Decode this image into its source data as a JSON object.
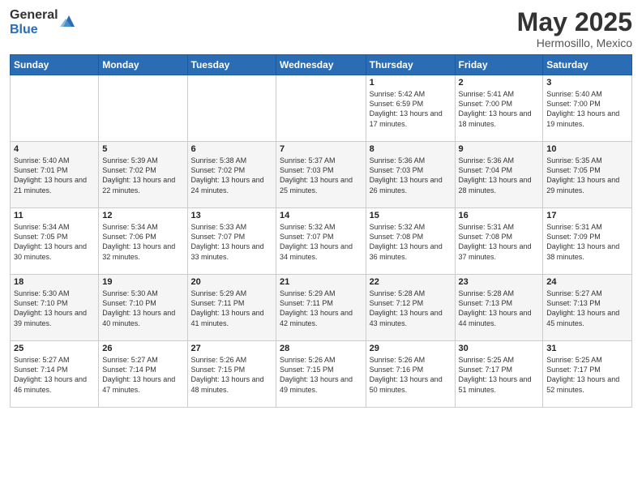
{
  "header": {
    "logo_general": "General",
    "logo_blue": "Blue",
    "month": "May 2025",
    "location": "Hermosillo, Mexico"
  },
  "weekdays": [
    "Sunday",
    "Monday",
    "Tuesday",
    "Wednesday",
    "Thursday",
    "Friday",
    "Saturday"
  ],
  "weeks": [
    [
      {
        "day": "",
        "sunrise": "",
        "sunset": "",
        "daylight": ""
      },
      {
        "day": "",
        "sunrise": "",
        "sunset": "",
        "daylight": ""
      },
      {
        "day": "",
        "sunrise": "",
        "sunset": "",
        "daylight": ""
      },
      {
        "day": "",
        "sunrise": "",
        "sunset": "",
        "daylight": ""
      },
      {
        "day": "1",
        "sunrise": "Sunrise: 5:42 AM",
        "sunset": "Sunset: 6:59 PM",
        "daylight": "Daylight: 13 hours and 17 minutes."
      },
      {
        "day": "2",
        "sunrise": "Sunrise: 5:41 AM",
        "sunset": "Sunset: 7:00 PM",
        "daylight": "Daylight: 13 hours and 18 minutes."
      },
      {
        "day": "3",
        "sunrise": "Sunrise: 5:40 AM",
        "sunset": "Sunset: 7:00 PM",
        "daylight": "Daylight: 13 hours and 19 minutes."
      }
    ],
    [
      {
        "day": "4",
        "sunrise": "Sunrise: 5:40 AM",
        "sunset": "Sunset: 7:01 PM",
        "daylight": "Daylight: 13 hours and 21 minutes."
      },
      {
        "day": "5",
        "sunrise": "Sunrise: 5:39 AM",
        "sunset": "Sunset: 7:02 PM",
        "daylight": "Daylight: 13 hours and 22 minutes."
      },
      {
        "day": "6",
        "sunrise": "Sunrise: 5:38 AM",
        "sunset": "Sunset: 7:02 PM",
        "daylight": "Daylight: 13 hours and 24 minutes."
      },
      {
        "day": "7",
        "sunrise": "Sunrise: 5:37 AM",
        "sunset": "Sunset: 7:03 PM",
        "daylight": "Daylight: 13 hours and 25 minutes."
      },
      {
        "day": "8",
        "sunrise": "Sunrise: 5:36 AM",
        "sunset": "Sunset: 7:03 PM",
        "daylight": "Daylight: 13 hours and 26 minutes."
      },
      {
        "day": "9",
        "sunrise": "Sunrise: 5:36 AM",
        "sunset": "Sunset: 7:04 PM",
        "daylight": "Daylight: 13 hours and 28 minutes."
      },
      {
        "day": "10",
        "sunrise": "Sunrise: 5:35 AM",
        "sunset": "Sunset: 7:05 PM",
        "daylight": "Daylight: 13 hours and 29 minutes."
      }
    ],
    [
      {
        "day": "11",
        "sunrise": "Sunrise: 5:34 AM",
        "sunset": "Sunset: 7:05 PM",
        "daylight": "Daylight: 13 hours and 30 minutes."
      },
      {
        "day": "12",
        "sunrise": "Sunrise: 5:34 AM",
        "sunset": "Sunset: 7:06 PM",
        "daylight": "Daylight: 13 hours and 32 minutes."
      },
      {
        "day": "13",
        "sunrise": "Sunrise: 5:33 AM",
        "sunset": "Sunset: 7:07 PM",
        "daylight": "Daylight: 13 hours and 33 minutes."
      },
      {
        "day": "14",
        "sunrise": "Sunrise: 5:32 AM",
        "sunset": "Sunset: 7:07 PM",
        "daylight": "Daylight: 13 hours and 34 minutes."
      },
      {
        "day": "15",
        "sunrise": "Sunrise: 5:32 AM",
        "sunset": "Sunset: 7:08 PM",
        "daylight": "Daylight: 13 hours and 36 minutes."
      },
      {
        "day": "16",
        "sunrise": "Sunrise: 5:31 AM",
        "sunset": "Sunset: 7:08 PM",
        "daylight": "Daylight: 13 hours and 37 minutes."
      },
      {
        "day": "17",
        "sunrise": "Sunrise: 5:31 AM",
        "sunset": "Sunset: 7:09 PM",
        "daylight": "Daylight: 13 hours and 38 minutes."
      }
    ],
    [
      {
        "day": "18",
        "sunrise": "Sunrise: 5:30 AM",
        "sunset": "Sunset: 7:10 PM",
        "daylight": "Daylight: 13 hours and 39 minutes."
      },
      {
        "day": "19",
        "sunrise": "Sunrise: 5:30 AM",
        "sunset": "Sunset: 7:10 PM",
        "daylight": "Daylight: 13 hours and 40 minutes."
      },
      {
        "day": "20",
        "sunrise": "Sunrise: 5:29 AM",
        "sunset": "Sunset: 7:11 PM",
        "daylight": "Daylight: 13 hours and 41 minutes."
      },
      {
        "day": "21",
        "sunrise": "Sunrise: 5:29 AM",
        "sunset": "Sunset: 7:11 PM",
        "daylight": "Daylight: 13 hours and 42 minutes."
      },
      {
        "day": "22",
        "sunrise": "Sunrise: 5:28 AM",
        "sunset": "Sunset: 7:12 PM",
        "daylight": "Daylight: 13 hours and 43 minutes."
      },
      {
        "day": "23",
        "sunrise": "Sunrise: 5:28 AM",
        "sunset": "Sunset: 7:13 PM",
        "daylight": "Daylight: 13 hours and 44 minutes."
      },
      {
        "day": "24",
        "sunrise": "Sunrise: 5:27 AM",
        "sunset": "Sunset: 7:13 PM",
        "daylight": "Daylight: 13 hours and 45 minutes."
      }
    ],
    [
      {
        "day": "25",
        "sunrise": "Sunrise: 5:27 AM",
        "sunset": "Sunset: 7:14 PM",
        "daylight": "Daylight: 13 hours and 46 minutes."
      },
      {
        "day": "26",
        "sunrise": "Sunrise: 5:27 AM",
        "sunset": "Sunset: 7:14 PM",
        "daylight": "Daylight: 13 hours and 47 minutes."
      },
      {
        "day": "27",
        "sunrise": "Sunrise: 5:26 AM",
        "sunset": "Sunset: 7:15 PM",
        "daylight": "Daylight: 13 hours and 48 minutes."
      },
      {
        "day": "28",
        "sunrise": "Sunrise: 5:26 AM",
        "sunset": "Sunset: 7:15 PM",
        "daylight": "Daylight: 13 hours and 49 minutes."
      },
      {
        "day": "29",
        "sunrise": "Sunrise: 5:26 AM",
        "sunset": "Sunset: 7:16 PM",
        "daylight": "Daylight: 13 hours and 50 minutes."
      },
      {
        "day": "30",
        "sunrise": "Sunrise: 5:25 AM",
        "sunset": "Sunset: 7:17 PM",
        "daylight": "Daylight: 13 hours and 51 minutes."
      },
      {
        "day": "31",
        "sunrise": "Sunrise: 5:25 AM",
        "sunset": "Sunset: 7:17 PM",
        "daylight": "Daylight: 13 hours and 52 minutes."
      }
    ]
  ]
}
